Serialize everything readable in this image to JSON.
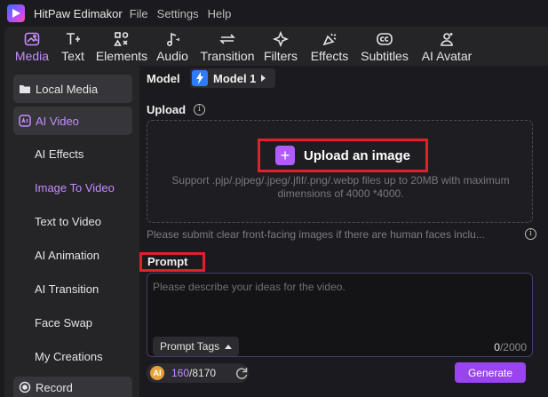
{
  "app": {
    "title": "HitPaw Edimakor",
    "menu": [
      "File",
      "Settings",
      "Help"
    ]
  },
  "toolbar": {
    "items": [
      {
        "label": "Media",
        "icon": "media-icon",
        "active": true
      },
      {
        "label": "Text",
        "icon": "text-icon"
      },
      {
        "label": "Elements",
        "icon": "elements-icon"
      },
      {
        "label": "Audio",
        "icon": "audio-icon"
      },
      {
        "label": "Transition",
        "icon": "transition-icon"
      },
      {
        "label": "Filters",
        "icon": "filters-icon"
      },
      {
        "label": "Effects",
        "icon": "effects-icon"
      },
      {
        "label": "Subtitles",
        "icon": "subtitles-icon"
      },
      {
        "label": "AI Avatar",
        "icon": "ai-avatar-icon"
      }
    ],
    "accent_color": "#c58cff"
  },
  "sidebar": {
    "local_media": "Local Media",
    "ai_video": "AI Video",
    "sub_items": [
      "AI Effects",
      "Image To Video",
      "Text to Video",
      "AI Animation",
      "AI Transition",
      "Face Swap",
      "My Creations"
    ],
    "active_sub": "Image To Video",
    "record": "Record"
  },
  "main": {
    "model_label": "Model",
    "model_value": "Model 1",
    "upload_label": "Upload",
    "upload_button": "Upload an image",
    "support_text": "Support .pjp/.pjpeg/.jpeg/.jfif/.png/.webp files up to 20MB with maximum dimensions of 4000 *4000.",
    "hint_text": "Please submit clear front-facing images if there are human faces inclu...",
    "prompt_label": "Prompt",
    "prompt_placeholder": "Please describe your ideas for the video.",
    "prompt_tags": "Prompt Tags",
    "char_count_current": "0",
    "char_count_max": "/2000",
    "credits_current": "160",
    "credits_total": "/8170",
    "generate": "Generate"
  },
  "colors": {
    "generate_button": "#9a44f0",
    "highlight_box": "#e0202a",
    "upload_plus": "#b25cff"
  }
}
